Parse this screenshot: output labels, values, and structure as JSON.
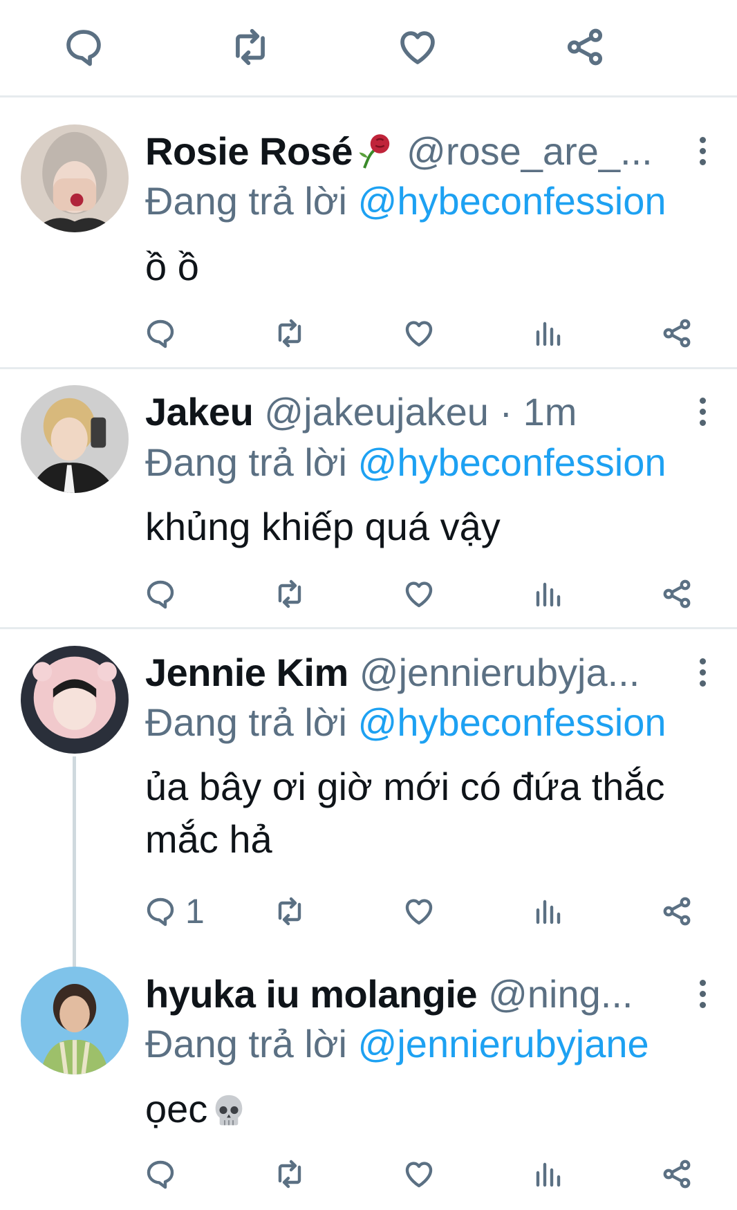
{
  "top_actions": [
    "reply-icon",
    "retweet-icon",
    "like-icon",
    "share-icon"
  ],
  "colors": {
    "link": "#1da1f2",
    "secondary": "#5b7083",
    "divider": "#e6ebee",
    "text": "#0f1419"
  },
  "tweets": [
    {
      "name": "Rosie Rosé",
      "name_emoji": "wilted-rose-emoji",
      "handle": "@rose_are_...",
      "reply_prefix": "Đang trả lời",
      "reply_to": "@hybeconfession",
      "text": "ồ ồ",
      "reply_count": ""
    },
    {
      "name": "Jakeu",
      "handle": "@jakeujakeu · 1m",
      "reply_prefix": "Đang trả lời",
      "reply_to": "@hybeconfession",
      "text": "khủng khiếp quá vậy",
      "reply_count": ""
    },
    {
      "name": "Jennie Kim",
      "handle": "@jennierubyja...",
      "reply_prefix": "Đang trả lời",
      "reply_to": "@hybeconfession",
      "text": "ủa bây ơi giờ mới có đứa thắc mắc hả",
      "reply_count": "1"
    },
    {
      "name": "hyuka iu molangie",
      "handle": "@ning...",
      "reply_prefix": "Đang trả lời",
      "reply_to": "@jennierubyjane",
      "text": "ọec",
      "text_emoji": "skull-emoji",
      "reply_count": ""
    }
  ]
}
